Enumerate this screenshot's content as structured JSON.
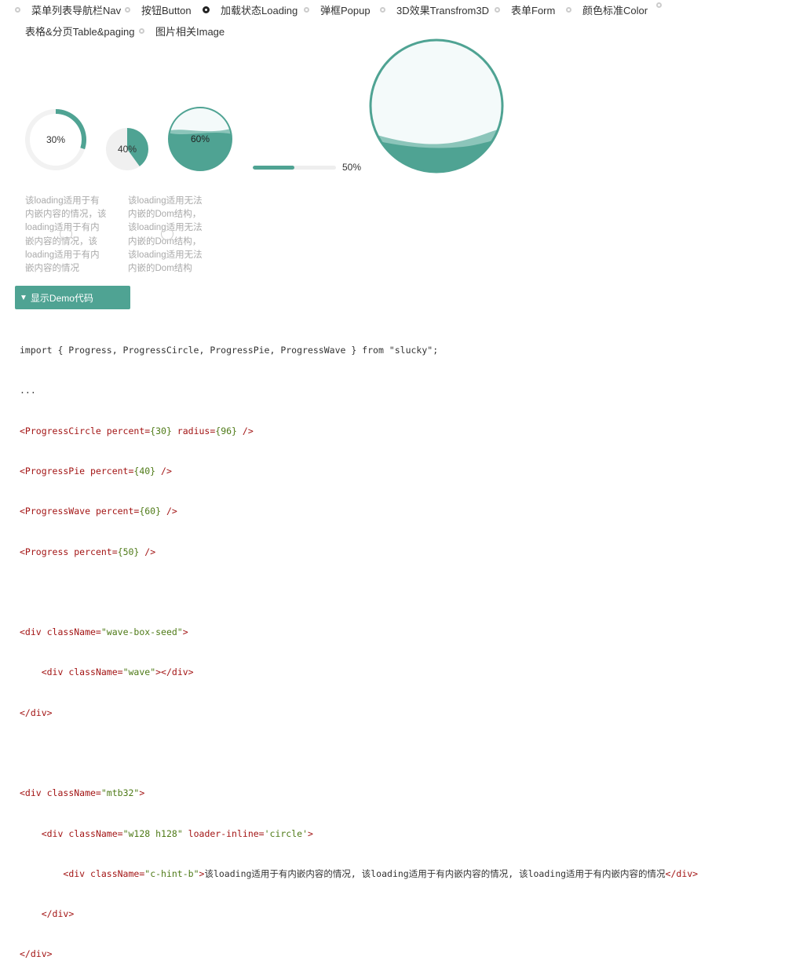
{
  "nav": {
    "items": [
      {
        "label": "菜单列表导航栏Nav",
        "active": false
      },
      {
        "label": "按钮Button",
        "active": false
      },
      {
        "label": "加载状态Loading",
        "active": true
      },
      {
        "label": "弹框Popup",
        "active": false
      },
      {
        "label": "3D效果Transfrom3D",
        "active": false
      },
      {
        "label": "表单Form",
        "active": false
      },
      {
        "label": "颜色标准Color",
        "active": false
      },
      {
        "label": "表格&分页Table&paging",
        "active": false
      },
      {
        "label": "图片相关Image",
        "active": false
      }
    ]
  },
  "progress": {
    "circle": {
      "label": "30%",
      "value": 30
    },
    "pie": {
      "label": "40%",
      "value": 40
    },
    "wave": {
      "label": "60%",
      "value": 60
    },
    "bar": {
      "label": "50%",
      "value": 50
    }
  },
  "colors": {
    "accent": "#4fa393",
    "wave_light": "#8cc5ba",
    "bg_light": "#f4fafa",
    "track": "#eeeeee"
  },
  "hints": {
    "left": [
      "该loading适用于有",
      "内嵌内容的情况，该",
      "loading适用于有内",
      "嵌内容的情况，该",
      "loading适用于有内",
      "嵌内容的情况"
    ],
    "right": [
      "该loading适用无法",
      "内嵌的Dom结构，",
      "该loading适用无法",
      "内嵌的Dom结构，",
      "该loading适用无法",
      "内嵌的Dom结构"
    ]
  },
  "toggle": {
    "icon": "▼",
    "label": "显示Demo代码"
  },
  "code": {
    "import_line": "import { Progress, ProgressCircle, ProgressPie, ProgressWave } from \"slucky\";",
    "ellipsis": "...",
    "l1": {
      "tag": "<ProgressCircle ",
      "attr1": "percent=",
      "v1": "{30}",
      "attr2": " radius=",
      "v2": "{96}",
      "end": " />"
    },
    "l2": {
      "tag": "<ProgressPie ",
      "attr1": "percent=",
      "v1": "{40}",
      "end": " />"
    },
    "l3": {
      "tag": "<ProgressWave ",
      "attr1": "percent=",
      "v1": "{60}",
      "end": " />"
    },
    "l4": {
      "tag": "<Progress ",
      "attr1": "percent=",
      "v1": "{50}",
      "end": " />"
    },
    "l6": {
      "tag": "<div ",
      "attr1": "className=",
      "v1": "\"wave-box-seed\"",
      "end": ">"
    },
    "l7": {
      "indent": "    ",
      "tag": "<div ",
      "attr1": "className=",
      "v1": "\"wave\"",
      "end": "></div>"
    },
    "l8": {
      "tag": "</div>"
    },
    "l10": {
      "tag": "<div ",
      "attr1": "className=",
      "v1": "\"mtb32\"",
      "end": ">"
    },
    "l11": {
      "indent": "    ",
      "tag": "<div ",
      "attr1": "className=",
      "v1": "\"w128 h128\"",
      "attr2": " loader-inline=",
      "v2": "'circle'",
      "end": ">"
    },
    "l12": {
      "indent": "        ",
      "tag": "<div ",
      "attr1": "className=",
      "v1": "\"c-hint-b\"",
      "end": ">",
      "text": "该loading适用于有内嵌内容的情况, 该loading适用于有内嵌内容的情况, 该loading适用于有内嵌内容的情况",
      "close": "</div>"
    },
    "l13": {
      "indent": "    ",
      "tag": "</div>"
    },
    "l14": {
      "tag": "</div>"
    }
  }
}
